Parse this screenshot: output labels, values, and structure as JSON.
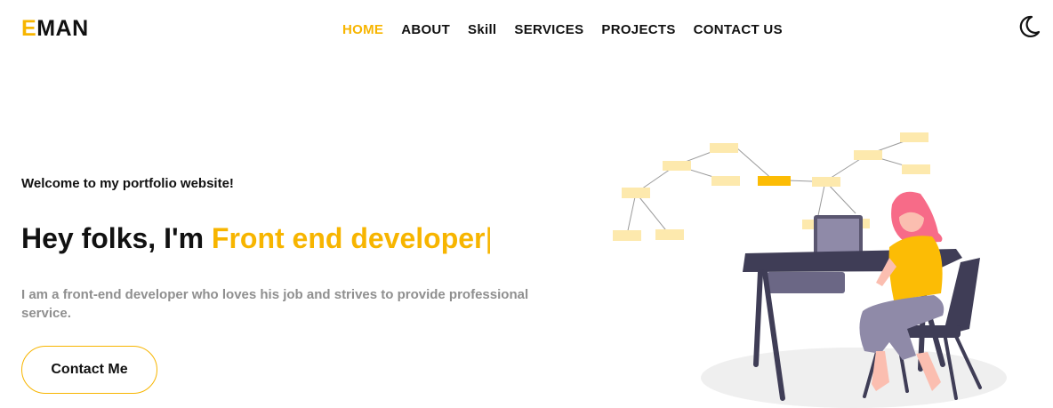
{
  "brand": {
    "first": "E",
    "rest": "MAN",
    "accent": "#f7b500"
  },
  "nav": {
    "items": [
      {
        "label": "HOME",
        "active": true
      },
      {
        "label": "ABOUT"
      },
      {
        "label": "Skill"
      },
      {
        "label": "SERVICES"
      },
      {
        "label": "PROJECTS"
      },
      {
        "label": "CONTACT US"
      }
    ]
  },
  "theme_toggle": {
    "icon": "moon-icon"
  },
  "hero": {
    "welcome": "Welcome to my portfolio website!",
    "greeting": "Hey folks, I'm ",
    "role": "Front end developer",
    "caret": "|",
    "description": "I am a front-end developer who loves his job and strives to provide professional service.",
    "cta_label": "Contact Me"
  },
  "illustration": {
    "icon": "developer-at-desk-illustration"
  }
}
